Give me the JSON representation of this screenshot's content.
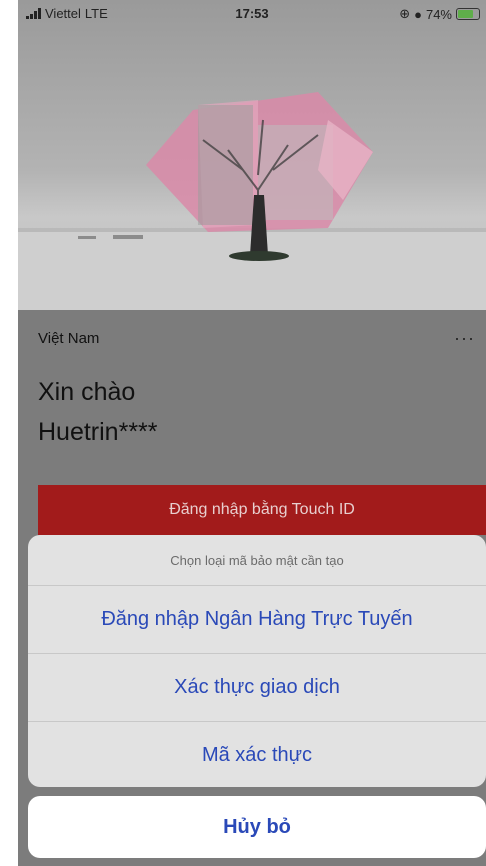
{
  "status_bar": {
    "carrier": "Viettel",
    "network": "LTE",
    "time": "17:53",
    "battery": "74%"
  },
  "profile": {
    "country": "Việt Nam",
    "more": "···",
    "greeting": "Xin chào",
    "username": "Huetrin****"
  },
  "touch_id_button": "Đăng nhập bằng Touch ID",
  "action_sheet": {
    "title": "Chọn loại mã bảo mật cần tạo",
    "options": [
      "Đăng nhập Ngân Hàng Trực Tuyến",
      "Xác thực giao dịch",
      "Mã xác thực"
    ],
    "cancel": "Hủy bỏ"
  },
  "colors": {
    "accent_blue": "#2a49b8",
    "brand_red": "#a21b1b"
  }
}
